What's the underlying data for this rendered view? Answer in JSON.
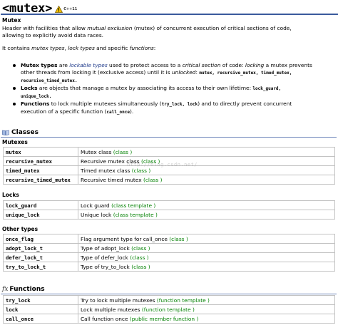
{
  "title": "<mutex>",
  "badge": "C++11",
  "header_name": "Mutex",
  "description": {
    "line1_a": "Header with facilities that allow ",
    "line1_b": "mutual exclusion",
    "line1_c": " (mutex) of concurrent execution of critical sections of code,",
    "line2": "allowing to explicitly avoid data races.",
    "contains_a": "It contains ",
    "contains_b": "mutex types",
    "contains_c": ", ",
    "contains_d": "lock types",
    "contains_e": " and specific ",
    "contains_f": "functions",
    "contains_g": ":"
  },
  "bullets": [
    {
      "term": "Mutex types",
      "t1": " are ",
      "t2": "lockable types",
      "t3": " used to protect access to a ",
      "t4": "critical section",
      "t5": " of code: ",
      "t6": "locking",
      "t7": " a mutex prevents",
      "line2a": "other threads from locking it (exclusive access) until it is ",
      "line2b": "unlocked",
      "line2c": ": ",
      "code1": "mutex, recursive_mutex, timed_mutex,",
      "code2": "recursive_timed_mutex."
    },
    {
      "term": "Locks",
      "t1": " are objects that manage a mutex by associating its access to their own lifetime: ",
      "code1": "lock_guard,",
      "code2": "unique_lock."
    },
    {
      "term": "Functions",
      "t1": " to lock multiple mutexes simultaneously (",
      "code1": "try_lock, lock",
      "t2": ") and to directly prevent concurrent",
      "line2a": "execution of a specific function (",
      "code2": "call_once",
      "line2b": ")."
    }
  ],
  "sections": {
    "classes": "Classes",
    "functions": "Functions"
  },
  "groups": {
    "mutexes": "Mutexes",
    "locks": "Locks",
    "other_types": "Other types"
  },
  "mutexes_rows": [
    {
      "name": "mutex",
      "desc": "Mutex class ",
      "kind": "(class )"
    },
    {
      "name": "recursive_mutex",
      "desc": "Recursive mutex class ",
      "kind": "(class )"
    },
    {
      "name": "timed_mutex",
      "desc": "Timed mutex class ",
      "kind": "(class )"
    },
    {
      "name": "recursive_timed_mutex",
      "desc": "Recursive timed mutex ",
      "kind": "(class )"
    }
  ],
  "locks_rows": [
    {
      "name": "lock_guard",
      "desc": "Lock guard ",
      "kind": "(class template )"
    },
    {
      "name": "unique_lock",
      "desc": "Unique lock ",
      "kind": "(class template )"
    }
  ],
  "other_rows": [
    {
      "name": "once_flag",
      "desc": "Flag argument type for call_once ",
      "kind": "(class )"
    },
    {
      "name": "adopt_lock_t",
      "desc": "Type of adopt_lock ",
      "kind": "(class )"
    },
    {
      "name": "defer_lock_t",
      "desc": "Type of defer_lock ",
      "kind": "(class )"
    },
    {
      "name": "try_to_lock_t",
      "desc": "Type of try_to_lock ",
      "kind": "(class )"
    }
  ],
  "function_rows": [
    {
      "name": "try_lock",
      "desc": "Try to lock multiple mutexes ",
      "kind": "(function template )"
    },
    {
      "name": "lock",
      "desc": "Lock multiple mutexes ",
      "kind": "(function template )"
    },
    {
      "name": "call_once",
      "desc": "Call function once ",
      "kind": "(public member function )"
    }
  ],
  "watermark": "http://blog.csdn.net/"
}
